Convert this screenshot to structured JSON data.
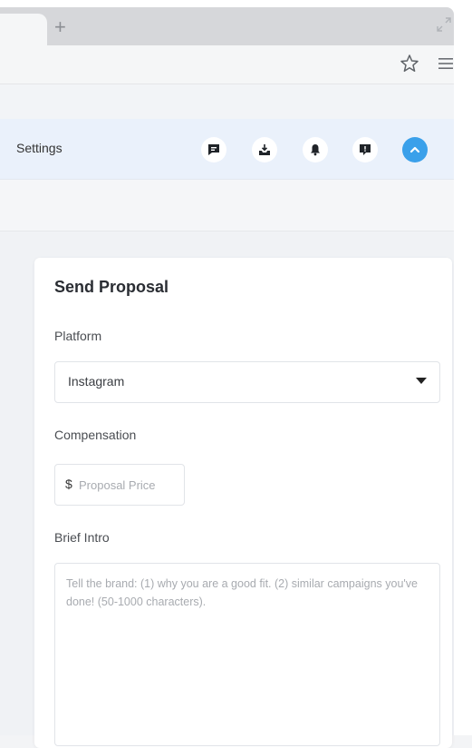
{
  "browser": {
    "new_tab_label": "+",
    "star_icon": "star-outline-icon",
    "menu_icon": "hamburger-menu-icon",
    "expand_icon": "expand-arrows-icon"
  },
  "header": {
    "title": "Settings",
    "icons": [
      "message-icon",
      "inbox-download-icon",
      "bell-icon",
      "feedback-icon",
      "avatar-chevron-up-icon"
    ],
    "accent_color": "#3aa0ea"
  },
  "proposal": {
    "title": "Send Proposal",
    "platform_label": "Platform",
    "platform_value": "Instagram",
    "compensation_label": "Compensation",
    "currency_symbol": "$",
    "price_placeholder": "Proposal Price",
    "intro_label": "Brief Intro",
    "intro_placeholder": "Tell the brand: (1) why you are a good fit. (2) similar campaigns you've done! (50-1000 characters)."
  }
}
